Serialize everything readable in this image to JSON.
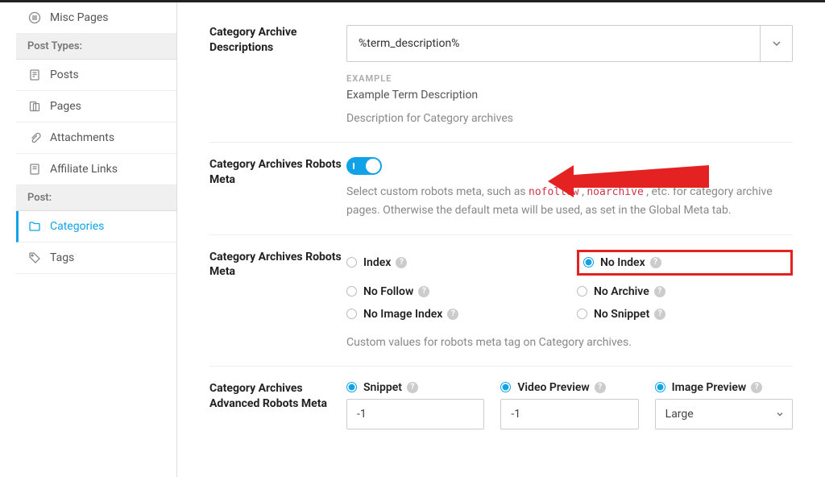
{
  "sidebar": {
    "header1": "Post Types:",
    "header2": "Post:",
    "items": [
      {
        "label": "Misc Pages"
      },
      {
        "label": "Posts"
      },
      {
        "label": "Pages"
      },
      {
        "label": "Attachments"
      },
      {
        "label": "Affiliate Links"
      },
      {
        "label": "Categories"
      },
      {
        "label": "Tags"
      }
    ]
  },
  "sections": [
    {
      "label": "Category Archive Descriptions",
      "value": "%term_description%",
      "example_label": "EXAMPLE",
      "example_text": "Example Term Description",
      "desc": "Description for Category archives"
    },
    {
      "label": "Category Archives Robots Meta",
      "toggle": true,
      "desc_pre": "Select custom robots meta, such as ",
      "code1": "nofollow",
      "code2": "noarchive",
      "desc_post": " , etc. for category archive pages. Otherwise the default meta will be used, as set in the Global Meta tab."
    },
    {
      "label": "Category Archives Robots Meta",
      "options": [
        "Index",
        "No Index",
        "No Follow",
        "No Archive",
        "No Image Index",
        "No Snippet"
      ],
      "selected": "No Index",
      "desc": "Custom values for robots meta tag on Category archives."
    },
    {
      "label": "Category Archives Advanced Robots Meta",
      "fields": [
        {
          "label": "Snippet",
          "value": "-1"
        },
        {
          "label": "Video Preview",
          "value": "-1"
        },
        {
          "label": "Image Preview",
          "value": "Large"
        }
      ]
    }
  ]
}
